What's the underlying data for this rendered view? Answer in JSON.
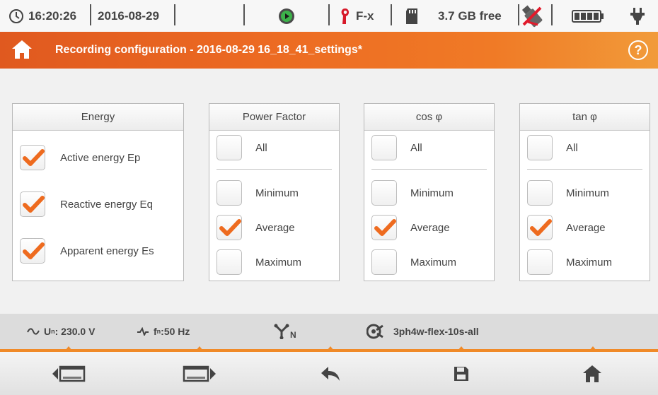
{
  "status": {
    "time": "16:20:26",
    "date": "2016-08-29",
    "clamp_label": "F-x",
    "storage_free": "3.7 GB free"
  },
  "header": {
    "title": "Recording configuration - 2016-08-29 16_18_41_settings*"
  },
  "panels": [
    {
      "title": "Energy",
      "items": [
        {
          "label": "Active energy Ep",
          "checked": true
        },
        {
          "label": "Reactive energy Eq",
          "checked": true
        },
        {
          "label": "Apparent energy Es",
          "checked": true
        }
      ]
    },
    {
      "title": "Power Factor",
      "all_label": "All",
      "items": [
        {
          "label": "Minimum",
          "checked": false
        },
        {
          "label": "Average",
          "checked": true
        },
        {
          "label": "Maximum",
          "checked": false
        }
      ]
    },
    {
      "title": "cos φ",
      "all_label": "All",
      "items": [
        {
          "label": "Minimum",
          "checked": false
        },
        {
          "label": "Average",
          "checked": true
        },
        {
          "label": "Maximum",
          "checked": false
        }
      ]
    },
    {
      "title": "tan φ",
      "all_label": "All",
      "items": [
        {
          "label": "Minimum",
          "checked": false
        },
        {
          "label": "Average",
          "checked": true
        },
        {
          "label": "Maximum",
          "checked": false
        }
      ]
    }
  ],
  "info": {
    "voltage_prefix": "U",
    "voltage_sub": "n",
    "voltage_value": ": 230.0 V",
    "freq_prefix": "f",
    "freq_sub": "n",
    "freq_value": ":50 Hz",
    "network_sub": "N",
    "config_name": "3ph4w-flex-10s-all"
  },
  "colors": {
    "accent": "#f07a26",
    "check": "#ee6b1f"
  }
}
